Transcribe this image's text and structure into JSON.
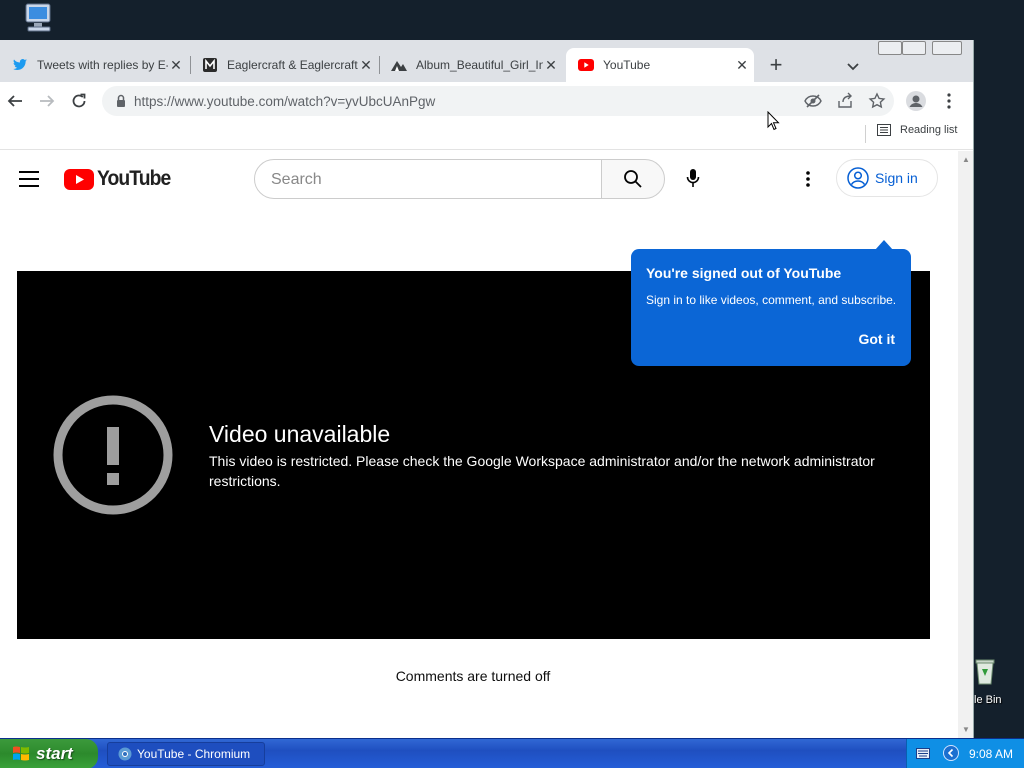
{
  "desktop": {
    "recycle_bin_label": "le Bin"
  },
  "browser": {
    "tabs": [
      {
        "title": "Tweets with replies by E-C",
        "favicon": "twitter-icon"
      },
      {
        "title": "Eaglercraft & EaglercraftX",
        "favicon": "m-letter-icon"
      },
      {
        "title": "Album_Beautiful_Girl_In_",
        "favicon": "mountain-icon"
      },
      {
        "title": "YouTube",
        "favicon": "youtube-icon"
      }
    ],
    "active_tab_index": 3,
    "url": "https://www.youtube.com/watch?v=yvUbcUAnPgw",
    "reading_list_label": "Reading list"
  },
  "youtube": {
    "logo_text": "YouTube",
    "search_placeholder": "Search",
    "signin_label": "Sign in",
    "error_title": "Video unavailable",
    "error_message": "This video is restricted. Please check the Google Workspace administrator and/or the network administrator restrictions.",
    "comments_status": "Comments are turned off",
    "tooltip": {
      "title": "You're signed out of YouTube",
      "body": "Sign in to like videos, comment, and subscribe.",
      "button": "Got it"
    }
  },
  "taskbar": {
    "start_label": "start",
    "task_label": "YouTube - Chromium",
    "clock": "9:08 AM"
  },
  "colors": {
    "youtube_red": "#ff0000",
    "link_blue": "#065fd4",
    "tooltip_blue": "#0b66d6",
    "xp_taskbar": "#245dd7",
    "xp_start_green": "#3c9a3c"
  }
}
